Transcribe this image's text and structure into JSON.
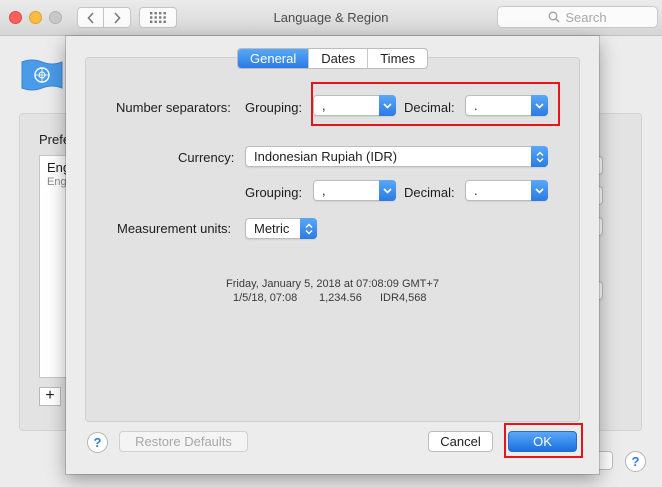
{
  "window": {
    "title": "Language & Region",
    "search_placeholder": "Search"
  },
  "parent": {
    "preferred_label": "Prefe",
    "language_name": "Eng",
    "language_sub": "Eng",
    "add_label": "+",
    "help_label": "?"
  },
  "sheet": {
    "tabs": [
      {
        "label": "General",
        "active": true
      },
      {
        "label": "Dates",
        "active": false
      },
      {
        "label": "Times",
        "active": false
      }
    ],
    "number_separators": {
      "label": "Number separators:",
      "grouping_label": "Grouping:",
      "grouping_value": ",",
      "decimal_label": "Decimal:",
      "decimal_value": "."
    },
    "currency": {
      "label": "Currency:",
      "value": "Indonesian Rupiah (IDR)",
      "grouping_label": "Grouping:",
      "grouping_value": ",",
      "decimal_label": "Decimal:",
      "decimal_value": "."
    },
    "measurement": {
      "label": "Measurement units:",
      "value": "Metric"
    },
    "sample": {
      "full_date": "Friday, January 5, 2018 at 07:08:09 GMT+7",
      "short_date": "1/5/18, 07:08",
      "number": "1,234.56",
      "currency": "IDR4,568"
    },
    "buttons": {
      "help": "?",
      "restore": "Restore Defaults",
      "cancel": "Cancel",
      "ok": "OK"
    }
  },
  "colors": {
    "accent": "#2a7be4",
    "highlight_box": "#e8141c"
  }
}
